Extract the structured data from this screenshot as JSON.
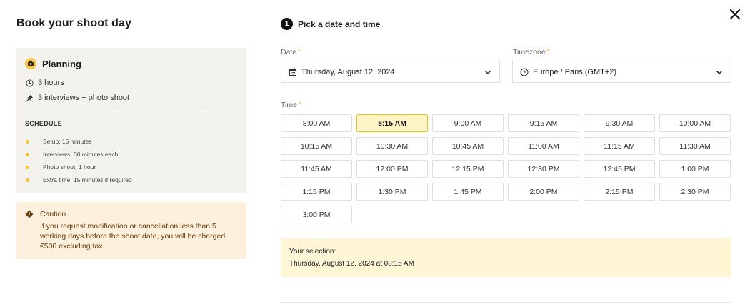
{
  "page": {
    "title": "Book your shoot day"
  },
  "planning": {
    "icon": "camera-emoji-icon",
    "title": "Planning",
    "duration": "3 hours",
    "content": "3 interviews + photo shoot",
    "schedule_label": "SCHEDULE",
    "schedule": [
      "Setup: 15 minutes",
      "Interviews: 30 minutes each",
      "Photo shoot: 1 hour",
      "Extra time: 15 minutes if required"
    ]
  },
  "caution": {
    "title": "Caution",
    "text": "If you request modification or cancellation less than 5 working days before the shoot date, you will be charged €500 excluding tax."
  },
  "step": {
    "number": "1",
    "title": "Pick a date and time"
  },
  "date_field": {
    "label": "Date",
    "required": "*",
    "value": "Thursday, August 12, 2024"
  },
  "timezone_field": {
    "label": "Timezone",
    "required": "*",
    "value": "Europe / Paris (GMT+2)"
  },
  "time_field": {
    "label": "Time",
    "required": "*"
  },
  "time_slots": [
    "8:00 AM",
    "8:15 AM",
    "9:00 AM",
    "9:15 AM",
    "9:30 AM",
    "10:00 AM",
    "10:15 AM",
    "10:30 AM",
    "10:45 AM",
    "11:00 AM",
    "11:15 AM",
    "11:30 AM",
    "11:45 AM",
    "12:00 PM",
    "12:15 PM",
    "12:30 PM",
    "12:45 PM",
    "1:00 PM",
    "1:15 PM",
    "1:30 PM",
    "1:45 PM",
    "2:00 PM",
    "2:15 PM",
    "2:30 PM",
    "3:00 PM"
  ],
  "selected_slot": "8:15 AM",
  "selection": {
    "label": "Your selection:",
    "value": "Thursday, August 12, 2024 at 08:15 AM"
  },
  "colors": {
    "accent": "#f1c200",
    "selected_bg": "#fff4c6",
    "caution_bg": "#fdf0dc",
    "card_bg": "#f4f2ee"
  }
}
